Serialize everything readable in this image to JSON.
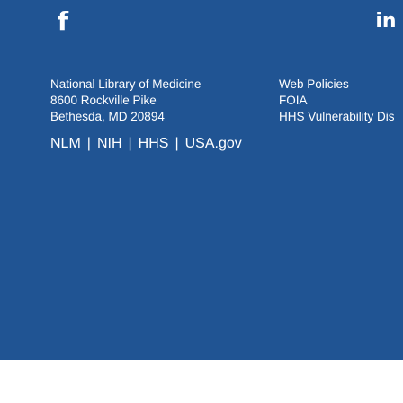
{
  "social": {
    "facebook_glyph": "f",
    "linkedin_glyph": "in"
  },
  "address": {
    "line1": "National Library of Medicine",
    "line2": "8600 Rockville Pike",
    "line3": "Bethesda, MD 20894"
  },
  "links": {
    "web_policies": "Web Policies",
    "foia": "FOIA",
    "vulnerability": "HHS Vulnerability Dis"
  },
  "agencies": {
    "nlm": "NLM",
    "nih": "NIH",
    "hhs": "HHS",
    "usa": "USA.gov",
    "separator": "|"
  },
  "colors": {
    "footer_bg": "#205493",
    "text": "#ffffff"
  }
}
